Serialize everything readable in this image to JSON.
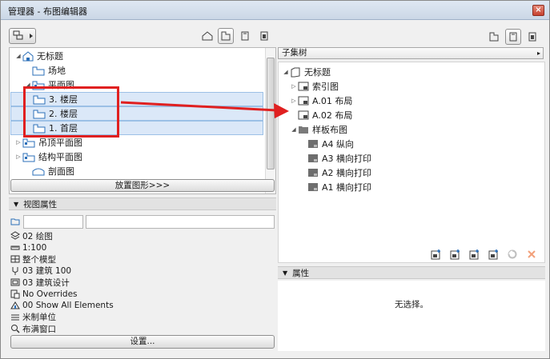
{
  "window": {
    "title": "管理器 - 布图编辑器",
    "close_label": "×"
  },
  "left": {
    "tree": [
      {
        "label": "无标题",
        "icon": "project-icon",
        "twisty": "◢"
      },
      {
        "label": "场地",
        "icon": "story-icon",
        "twisty": ""
      },
      {
        "label": "平面图",
        "icon": "floorplan-icon",
        "twisty": "◢"
      },
      {
        "label": "3. 楼层",
        "icon": "story-icon",
        "twisty": "",
        "selected": true
      },
      {
        "label": "2. 楼层",
        "icon": "story-icon",
        "twisty": "",
        "selected": true
      },
      {
        "label": "1. 首层",
        "icon": "story-icon",
        "twisty": "",
        "selected": true
      },
      {
        "label": "吊顶平面图",
        "icon": "floorplan-icon",
        "twisty": "▷"
      },
      {
        "label": "结构平面图",
        "icon": "floorplan-icon",
        "twisty": "▷"
      },
      {
        "label": "剖面图",
        "icon": "section-icon",
        "twisty": ""
      }
    ],
    "place_button": "放置图形>>>",
    "view_props_header": "视图属性",
    "props": [
      {
        "icon": "layer-combo-icon",
        "text": "02 绘图"
      },
      {
        "icon": "scale-icon",
        "text": "1:100"
      },
      {
        "icon": "model-icon",
        "text": "整个模型"
      },
      {
        "icon": "pen-icon",
        "text": "03 建筑 100"
      },
      {
        "icon": "display-icon",
        "text": "03 建筑设计"
      },
      {
        "icon": "override-icon",
        "text": "No Overrides"
      },
      {
        "icon": "renovation-icon",
        "text": "00 Show All Elements"
      },
      {
        "icon": "unit-icon",
        "text": "米制单位"
      },
      {
        "icon": "zoom-icon",
        "text": "布满窗口"
      }
    ],
    "settings_button": "设置..."
  },
  "right": {
    "dropdown_label": "子集树",
    "tree": [
      {
        "label": "无标题",
        "icon": "book-icon",
        "twisty": "◢"
      },
      {
        "label": "索引图",
        "icon": "layout-icon",
        "twisty": "▷"
      },
      {
        "label": "A.01 布局",
        "icon": "layout-icon",
        "twisty": "▷"
      },
      {
        "label": "A.02 布局",
        "icon": "layout-icon",
        "twisty": ""
      },
      {
        "label": "样板布图",
        "icon": "folder-icon",
        "twisty": "◢"
      },
      {
        "label": "A4 纵向",
        "icon": "master-icon",
        "twisty": ""
      },
      {
        "label": "A3 横向打印",
        "icon": "master-icon",
        "twisty": ""
      },
      {
        "label": "A2 横向打印",
        "icon": "master-icon",
        "twisty": ""
      },
      {
        "label": "A1 横向打印",
        "icon": "master-icon",
        "twisty": ""
      }
    ],
    "props_header": "属性",
    "no_selection": "无选择。"
  }
}
